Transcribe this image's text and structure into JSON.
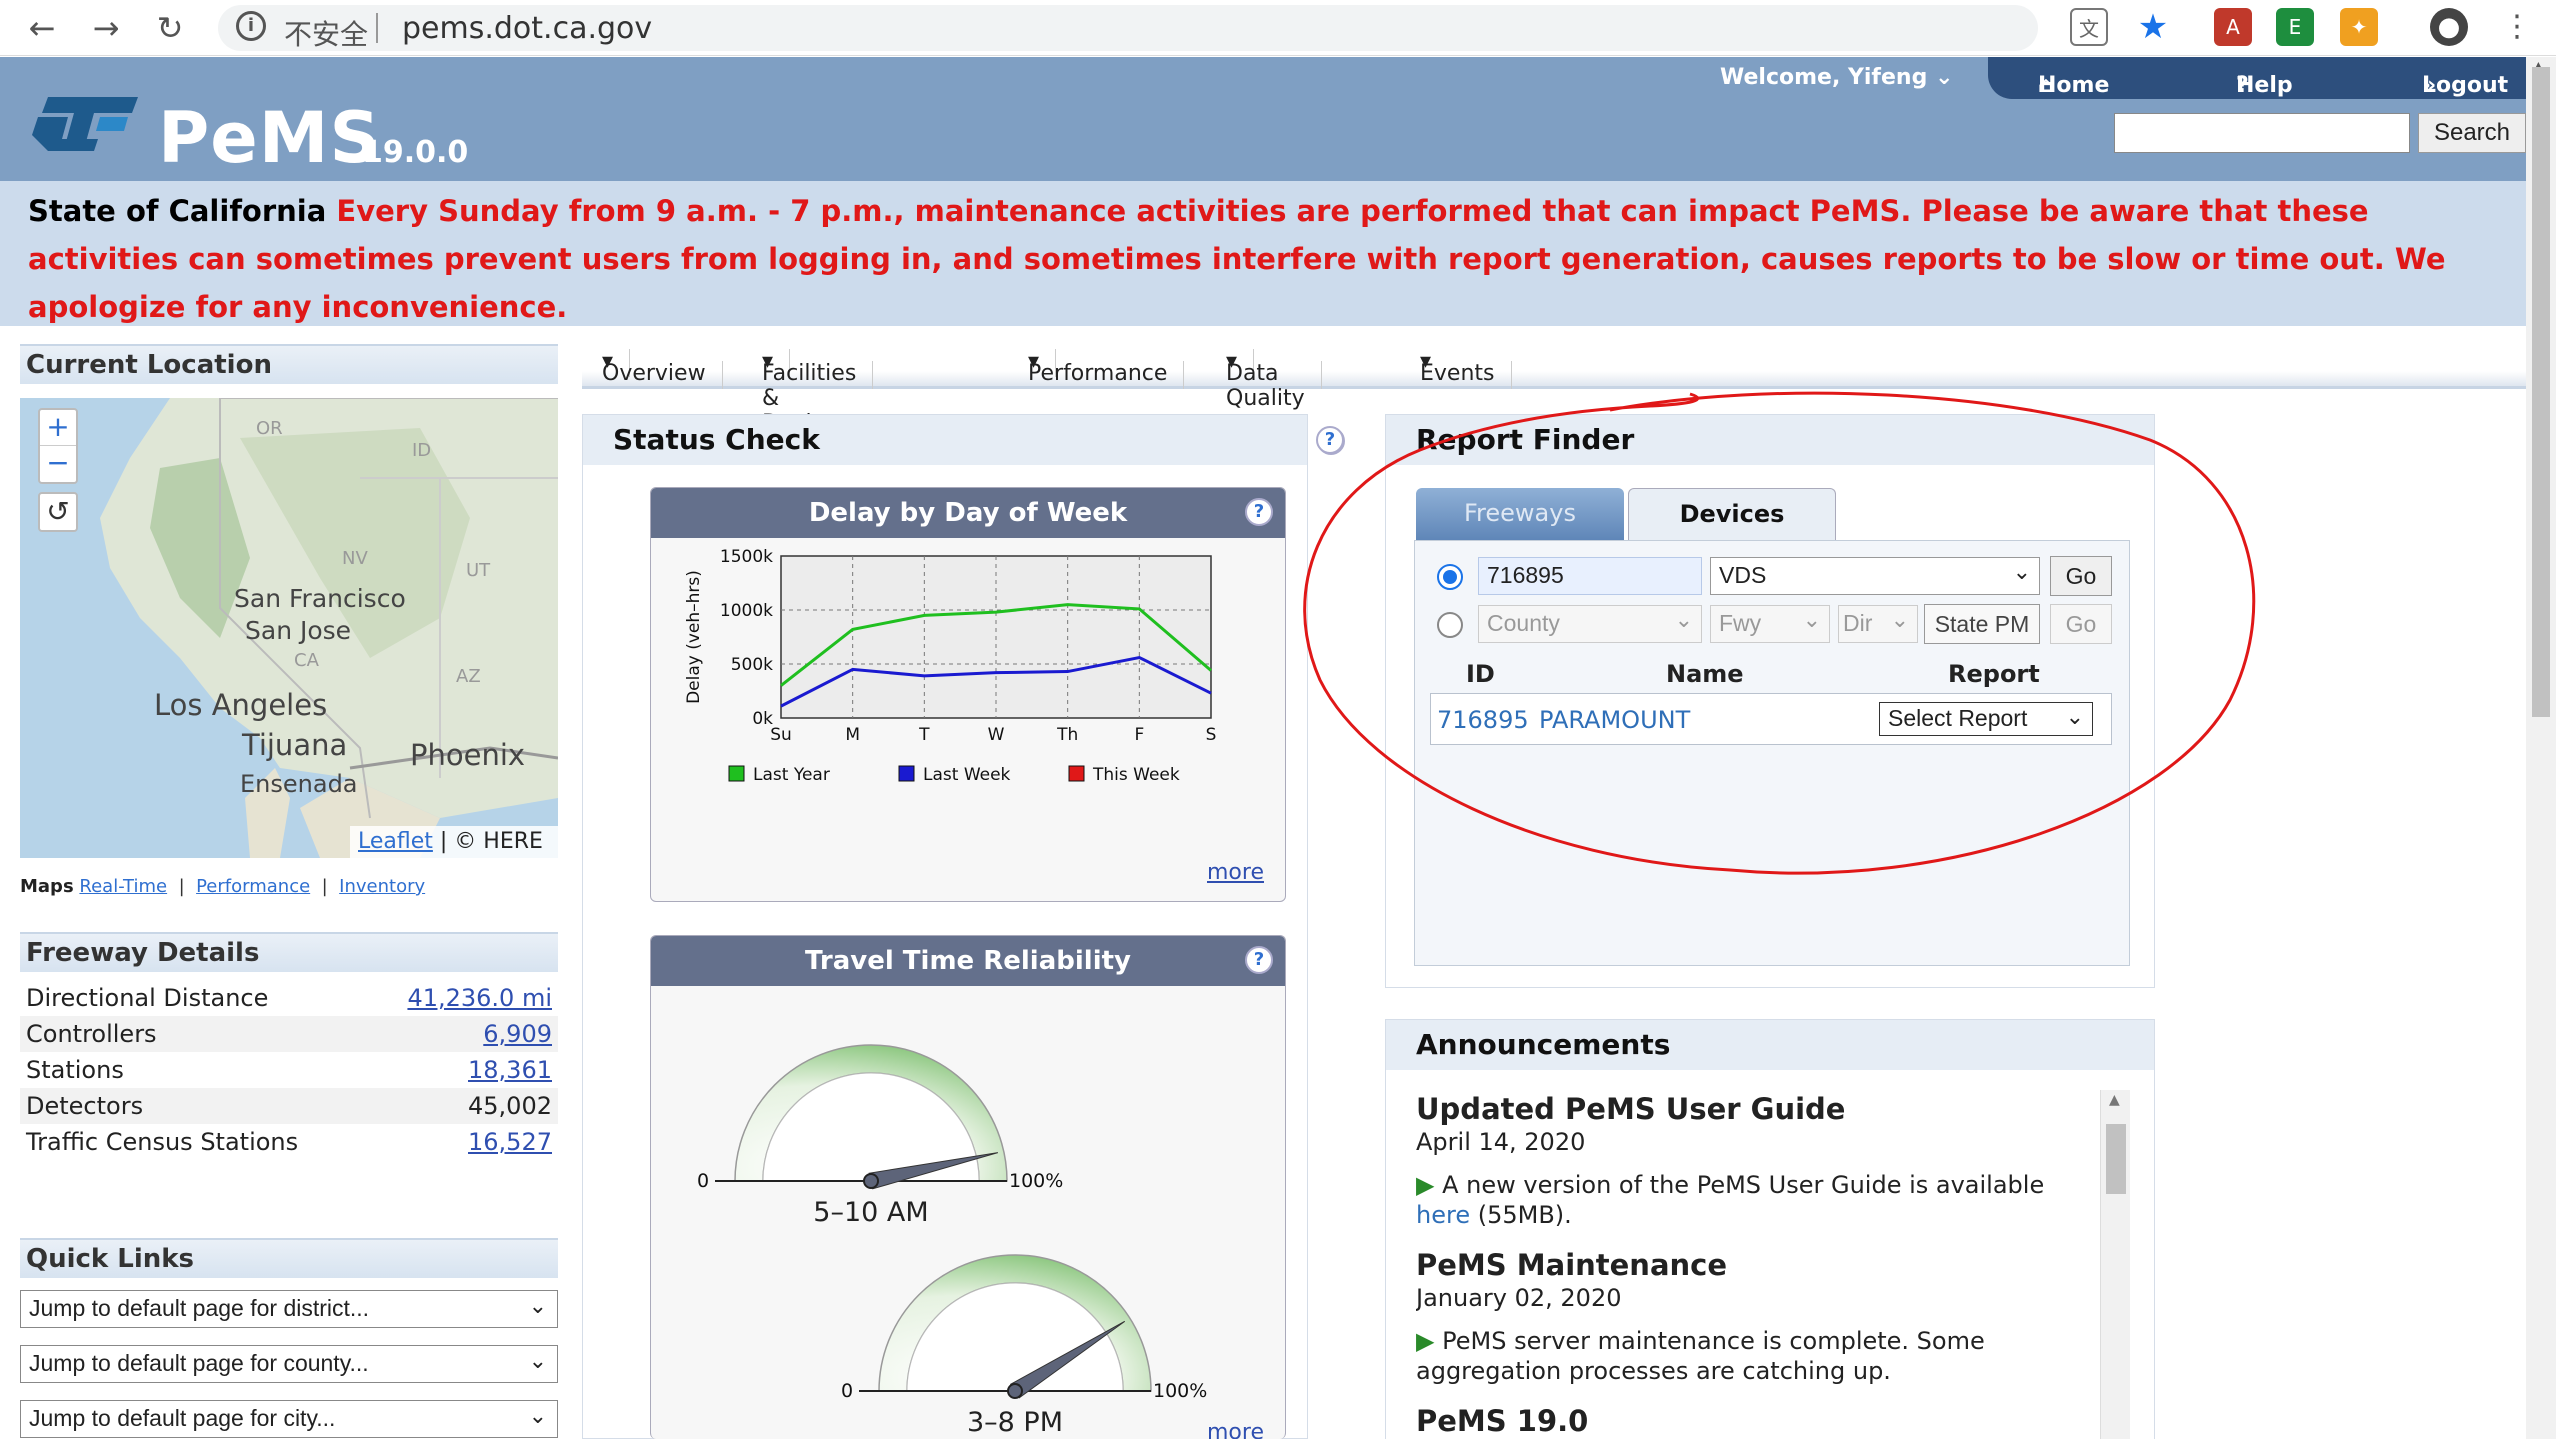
{
  "browser": {
    "insecure_label": "不安全",
    "url": "pems.dot.ca.gov"
  },
  "header": {
    "logo_text": "PeMS",
    "version": "19.0.0",
    "welcome": "Welcome, Yifeng",
    "nav": {
      "home": "Home",
      "help": "Help",
      "logout": "Logout"
    },
    "search_button": "Search",
    "search_value": ""
  },
  "notice": {
    "state": "State of California",
    "message": "Every Sunday from 9 a.m. - 7 p.m., maintenance activities are performed that can impact PeMS. Please be aware that these activities can sometimes prevent users from logging in, and sometimes interfere with report generation, causes reports to be slow or time out. We apologize for any inconvenience."
  },
  "left": {
    "current_location_title": "Current Location",
    "map_labels": {
      "or": "OR",
      "id": "ID",
      "nv": "NV",
      "ut": "UT",
      "ca": "CA",
      "az": "AZ",
      "san_francisco": "San Francisco",
      "san_jose": "San Jose",
      "los_angeles": "Los Angeles",
      "tijuana": "Tijuana",
      "ensenada": "Ensenada",
      "phoenix": "Phoenix"
    },
    "attribution": {
      "leaflet": "Leaflet",
      "separator": "| © HERE"
    },
    "maps_links": {
      "label": "Maps",
      "realtime": "Real-Time",
      "performance": "Performance",
      "inventory": "Inventory"
    },
    "freeway_details_title": "Freeway Details",
    "freeway_details": [
      {
        "label": "Directional Distance",
        "value": "41,236.0 mi",
        "link": true
      },
      {
        "label": "Controllers",
        "value": "6,909",
        "link": true
      },
      {
        "label": "Stations",
        "value": "18,361",
        "link": true
      },
      {
        "label": "Detectors",
        "value": "45,002",
        "link": false
      },
      {
        "label": "Traffic Census Stations",
        "value": "16,527",
        "link": true
      }
    ],
    "quick_links_title": "Quick Links",
    "quick_links": [
      "Jump to default page for district...",
      "Jump to default page for county...",
      "Jump to default page for city..."
    ]
  },
  "menubar": [
    "Overview",
    "Facilities & Devices",
    "Performance",
    "Data Quality",
    "Events"
  ],
  "status_check": {
    "title": "Status Check",
    "delay_title": "Delay by Day of Week",
    "travel_title": "Travel Time Reliability",
    "more": "more",
    "gauges": [
      {
        "label": "5–10 AM",
        "min": "0",
        "max": "100%",
        "value": 0.93
      },
      {
        "label": "3–8 PM",
        "min": "0",
        "max": "100%",
        "value": 0.82
      }
    ]
  },
  "chart_data": {
    "type": "line",
    "title": "Delay by Day of Week",
    "ylabel": "Delay (veh–hrs)",
    "xlabel": "",
    "categories": [
      "Su",
      "M",
      "T",
      "W",
      "Th",
      "F",
      "S"
    ],
    "yticks": [
      "0k",
      "500k",
      "1000k",
      "1500k"
    ],
    "ylim": [
      0,
      1500000
    ],
    "grid": true,
    "legend_position": "bottom",
    "series": [
      {
        "name": "Last Year",
        "color": "#1fbf1f",
        "values": [
          300000,
          820000,
          950000,
          980000,
          1050000,
          1010000,
          440000
        ]
      },
      {
        "name": "Last Week",
        "color": "#1a1ad0",
        "values": [
          110000,
          450000,
          390000,
          420000,
          430000,
          560000,
          230000
        ]
      },
      {
        "name": "This Week",
        "color": "#e01818",
        "values": []
      }
    ]
  },
  "report_finder": {
    "title": "Report Finder",
    "tabs": {
      "freeways": "Freeways",
      "devices": "Devices"
    },
    "id_value": "716895",
    "type_value": "VDS",
    "go": "Go",
    "county_placeholder": "County",
    "fwy_placeholder": "Fwy",
    "dir_placeholder": "Dir",
    "state_pm_placeholder": "State PM",
    "columns": {
      "id": "ID",
      "name": "Name",
      "report": "Report"
    },
    "result": {
      "id": "716895",
      "name": "PARAMOUNT",
      "report": "Select Report"
    }
  },
  "announcements": {
    "title": "Announcements",
    "items": [
      {
        "title": "Updated PeMS User Guide",
        "date": "April 14, 2020",
        "body": "A new version of the PeMS User Guide is available",
        "link": "here",
        "tail": "(55MB)."
      },
      {
        "title": "PeMS Maintenance",
        "date": "January 02, 2020",
        "body": "PeMS server maintenance is complete. Some aggregation processes are catching up."
      },
      {
        "title": "PeMS 19.0"
      }
    ]
  },
  "colors": {
    "header": "#7f9fc3",
    "nav": "#2d4f7d",
    "notice_bg": "#ccdbec",
    "alert": "#e01818",
    "annotation": "#e01818"
  }
}
